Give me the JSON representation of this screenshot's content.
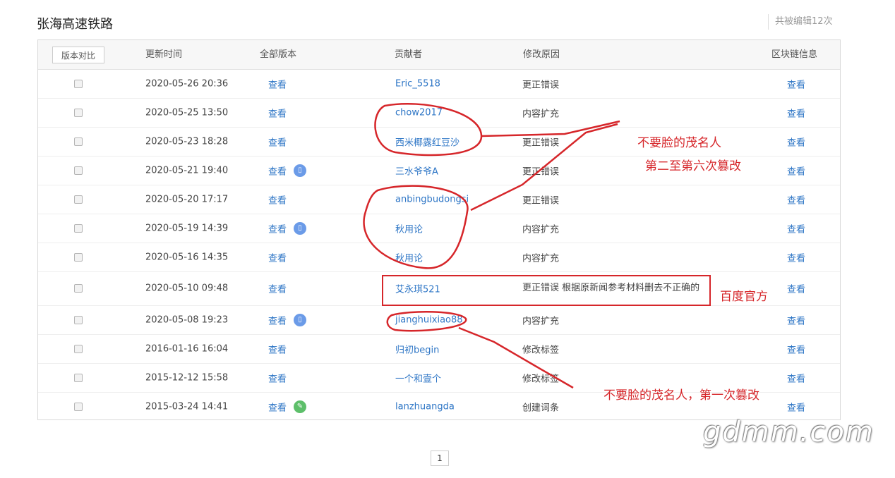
{
  "page_title": "张海高速铁路",
  "edit_count": "共被编辑12次",
  "compare_button": "版本对比",
  "columns": {
    "time": "更新时间",
    "version": "全部版本",
    "contributor": "贡献者",
    "reason": "修改原因",
    "chain": "区块链信息"
  },
  "rows": [
    {
      "time": "2020-05-26 20:36",
      "view": "查看",
      "badge": "",
      "contributor": "Eric_5518",
      "reason": "更正错误",
      "chain": "查看"
    },
    {
      "time": "2020-05-25 13:50",
      "view": "查看",
      "badge": "",
      "contributor": "chow2017",
      "reason": "内容扩充",
      "chain": "查看"
    },
    {
      "time": "2020-05-23 18:28",
      "view": "查看",
      "badge": "",
      "contributor": "西米椰露红豆沙",
      "reason": "更正错误",
      "chain": "查看"
    },
    {
      "time": "2020-05-21 19:40",
      "view": "查看",
      "badge": "mobile",
      "contributor": "三水爷爷A",
      "reason": "更正错误",
      "chain": "查看"
    },
    {
      "time": "2020-05-20 17:17",
      "view": "查看",
      "badge": "",
      "contributor": "anbingbudongsi",
      "reason": "更正错误",
      "chain": "查看"
    },
    {
      "time": "2020-05-19 14:39",
      "view": "查看",
      "badge": "mobile",
      "contributor": "秋用论",
      "reason": "内容扩充",
      "chain": "查看"
    },
    {
      "time": "2020-05-16 14:35",
      "view": "查看",
      "badge": "",
      "contributor": "秋用论",
      "reason": "内容扩充",
      "chain": "查看"
    },
    {
      "time": "2020-05-10 09:48",
      "view": "查看",
      "badge": "",
      "contributor": "艾永琪521",
      "reason": "更正错误 根据原新闻参考材料删去不正确的",
      "chain": "查看"
    },
    {
      "time": "2020-05-08 19:23",
      "view": "查看",
      "badge": "mobile",
      "contributor": "jianghuixiao88",
      "reason": "内容扩充",
      "chain": "查看"
    },
    {
      "time": "2016-01-16 16:04",
      "view": "查看",
      "badge": "",
      "contributor": "归初begin",
      "reason": "修改标签",
      "chain": "查看"
    },
    {
      "time": "2015-12-12 15:58",
      "view": "查看",
      "badge": "",
      "contributor": "一个和壹个",
      "reason": "修改标签",
      "chain": "查看"
    },
    {
      "time": "2015-03-24 14:41",
      "view": "查看",
      "badge": "edit",
      "contributor": "lanzhuangda",
      "reason": "创建词条",
      "chain": "查看"
    }
  ],
  "annotations": {
    "a1_line1": "不要脸的茂名人",
    "a1_line2": "第二至第六次篡改",
    "a2": "百度官方",
    "a3": "不要脸的茂名人，第一次篡改"
  },
  "watermark": "gdmm.com",
  "pagination": {
    "current": "1"
  },
  "annotation_color": "#d6262a"
}
